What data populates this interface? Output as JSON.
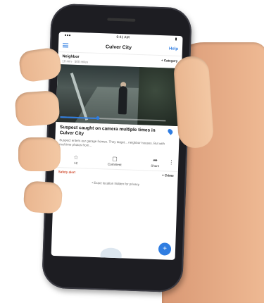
{
  "status": {
    "time": "9:41 AM"
  },
  "nav": {
    "title": "Culver City",
    "help": "Help"
  },
  "post": {
    "tag": "Neighbor",
    "subtitle": "10 min · 500 miles",
    "category_button": "+ Category",
    "headline": "Suspect caught on camera multiple times in Culver City",
    "body": "Suspect enters our garage homes. They target... neighbor houses. But with real time photos from...",
    "actions": [
      {
        "icon": "☆",
        "label": "12"
      },
      {
        "icon": "▢",
        "label": "Comment"
      },
      {
        "icon": "➦",
        "label": "Share"
      }
    ],
    "progress": 0.35
  },
  "footer_row": {
    "left": "Safety alert",
    "right": "+ Crime"
  },
  "privacy_text": "• Exact location hidden for privacy",
  "fab": "+",
  "colors": {
    "accent": "#2f7de1",
    "alert": "#d04a2d"
  }
}
